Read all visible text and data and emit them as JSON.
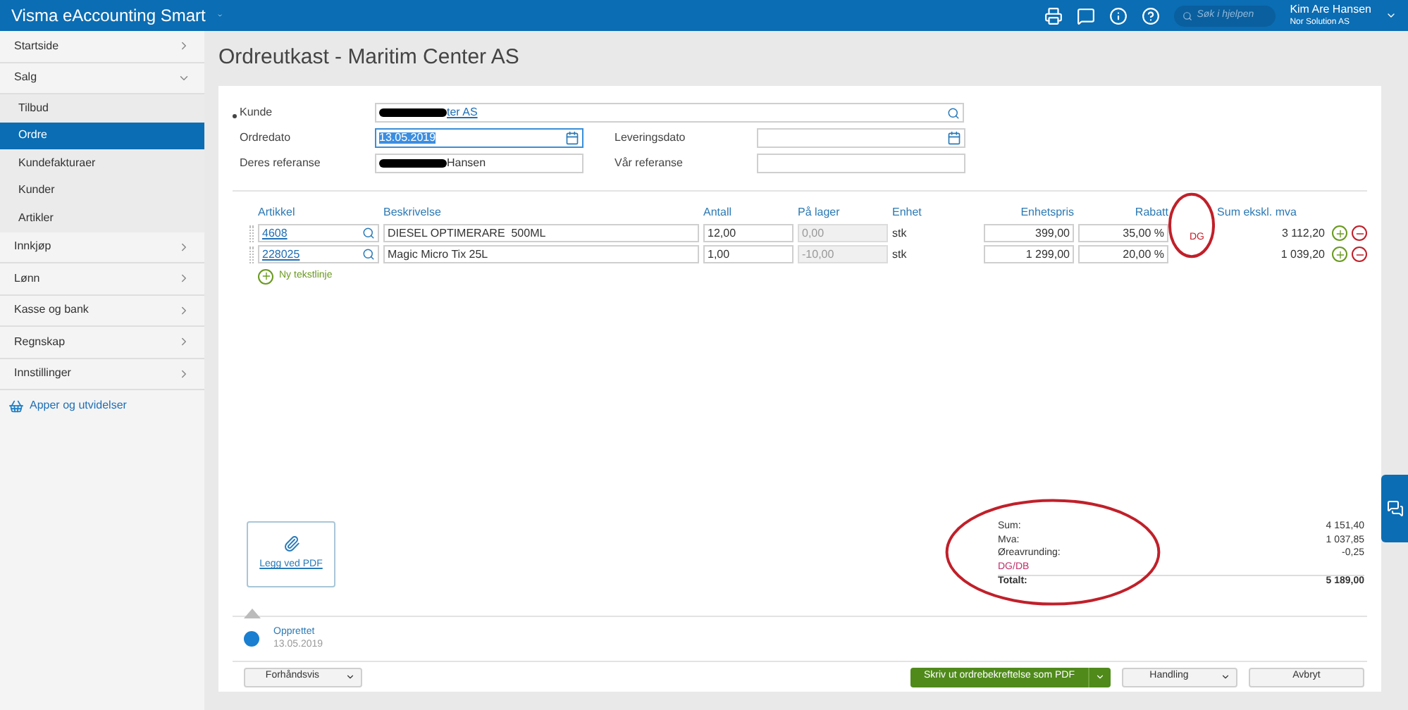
{
  "header": {
    "app_title": "Visma eAccounting Smart",
    "search_placeholder": "Søk i hjelpen",
    "user_name": "Kim Are Hansen",
    "company": "Nor Solution AS"
  },
  "sidebar": {
    "items": [
      {
        "label": "Startside",
        "expanded": false
      },
      {
        "label": "Salg",
        "expanded": true,
        "children": [
          {
            "label": "Tilbud",
            "selected": false
          },
          {
            "label": "Ordre",
            "selected": true
          },
          {
            "label": "Kundefakturaer",
            "selected": false
          },
          {
            "label": "Kunder",
            "selected": false
          },
          {
            "label": "Artikler",
            "selected": false
          }
        ]
      },
      {
        "label": "Innkjøp",
        "expanded": false
      },
      {
        "label": "Lønn",
        "expanded": false
      },
      {
        "label": "Kasse og bank",
        "expanded": false
      },
      {
        "label": "Regnskap",
        "expanded": false
      },
      {
        "label": "Innstillinger",
        "expanded": false
      }
    ],
    "apps_link": "Apper og utvidelser"
  },
  "page_title": "Ordreutkast - Maritim Center AS",
  "form": {
    "left": [
      {
        "label": "Kunde",
        "value": "ter AS",
        "kind": "lookup",
        "required": true,
        "redacted": true,
        "focused": false
      },
      {
        "label": "Ordredato",
        "value": "13.05.2019",
        "kind": "date",
        "required": false,
        "redacted": false,
        "focused": true
      },
      {
        "label": "Deres referanse",
        "value": "Hansen",
        "kind": "text",
        "required": false,
        "redacted": true,
        "focused": false
      }
    ],
    "right": [
      {
        "label": "Leveringsdato",
        "kind": "date"
      },
      {
        "label": "Vår referanse",
        "kind": "text"
      }
    ]
  },
  "table": {
    "columns": [
      "Artikkel",
      "Beskrivelse",
      "Antall",
      "På lager",
      "Enhet",
      "Enhetspris",
      "Rabatt",
      "Sum ekskl. mva"
    ],
    "rows": [
      {
        "artikkel": "4608",
        "beskrivelse": "DIESEL OPTIMERARE  500ML",
        "antall": "12,00",
        "paa_lager": "0,00",
        "enhet": "stk",
        "enhetspris": "399,00",
        "rabatt": "35,00 %",
        "dg": "DG",
        "sum": "3 112,20"
      },
      {
        "artikkel": "228025",
        "beskrivelse": "Magic Micro Tix 25L",
        "antall": "1,00",
        "paa_lager": "-10,00",
        "enhet": "stk",
        "enhetspris": "1 299,00",
        "rabatt": "20,00 %",
        "sum": "1 039,20"
      }
    ],
    "add_line": "Ny tekstlinje"
  },
  "attach_label": "Legg ved PDF",
  "totals": [
    {
      "label": "Sum:",
      "value": "4 151,40",
      "kind": "normal"
    },
    {
      "label": "Mva:",
      "value": "1 037,85",
      "kind": "normal"
    },
    {
      "label": "Øreavrunding:",
      "value": "-0,25",
      "kind": "normal"
    },
    {
      "label": "DG/DB",
      "kind": "dg"
    },
    {
      "label": "Totalt:",
      "value": "5 189,00",
      "kind": "total"
    }
  ],
  "history": {
    "status": "Opprettet",
    "date": "13.05.2019"
  },
  "footer_buttons": [
    {
      "label": "Forhåndsvis",
      "kind": "default",
      "dropdown": true
    },
    {
      "label": "Skriv ut ordrebekreftelse som PDF",
      "kind": "primary",
      "dropdown": true
    },
    {
      "label": "Handling",
      "kind": "default",
      "dropdown": true
    },
    {
      "label": "Avbryt",
      "kind": "default",
      "dropdown": false
    }
  ],
  "annotations": [
    {
      "kind": "ellipse"
    },
    {
      "kind": "ellipse"
    }
  ]
}
